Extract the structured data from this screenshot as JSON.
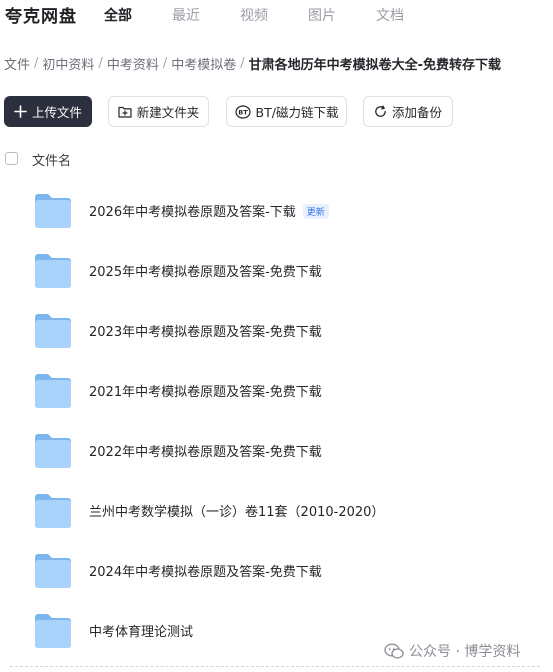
{
  "app": {
    "brand": "夸克网盘"
  },
  "nav": {
    "tabs": [
      "全部",
      "最近",
      "视频",
      "图片",
      "文档"
    ],
    "active": "全部"
  },
  "breadcrumb": [
    "文件",
    "初中资料",
    "中考资料",
    "中考模拟卷",
    "甘肃各地历年中考模拟卷大全-免费转存下载"
  ],
  "toolbar": {
    "upload": "上传文件",
    "new_folder": "新建文件夹",
    "bt": "BT/磁力链下载",
    "backup": "添加备份"
  },
  "list": {
    "column_header": "文件名",
    "items": [
      {
        "name": "2026年中考模拟卷原题及答案-下载",
        "badge": "更新"
      },
      {
        "name": "2025年中考模拟卷原题及答案-免费下载"
      },
      {
        "name": "2023年中考模拟卷原题及答案-免费下载"
      },
      {
        "name": "2021年中考模拟卷原题及答案-免费下载"
      },
      {
        "name": "2022年中考模拟卷原题及答案-免费下载"
      },
      {
        "name": "兰州中考数学模拟（一诊）卷11套（2010-2020）"
      },
      {
        "name": "2024年中考模拟卷原题及答案-免费下载"
      },
      {
        "name": "中考体育理论测试"
      }
    ]
  },
  "watermark": {
    "text": "公众号 · 博学资料"
  },
  "colors": {
    "primary_button": "#2c2f3e",
    "folder": "#8fc3f5",
    "badge": "#3b73f0"
  }
}
